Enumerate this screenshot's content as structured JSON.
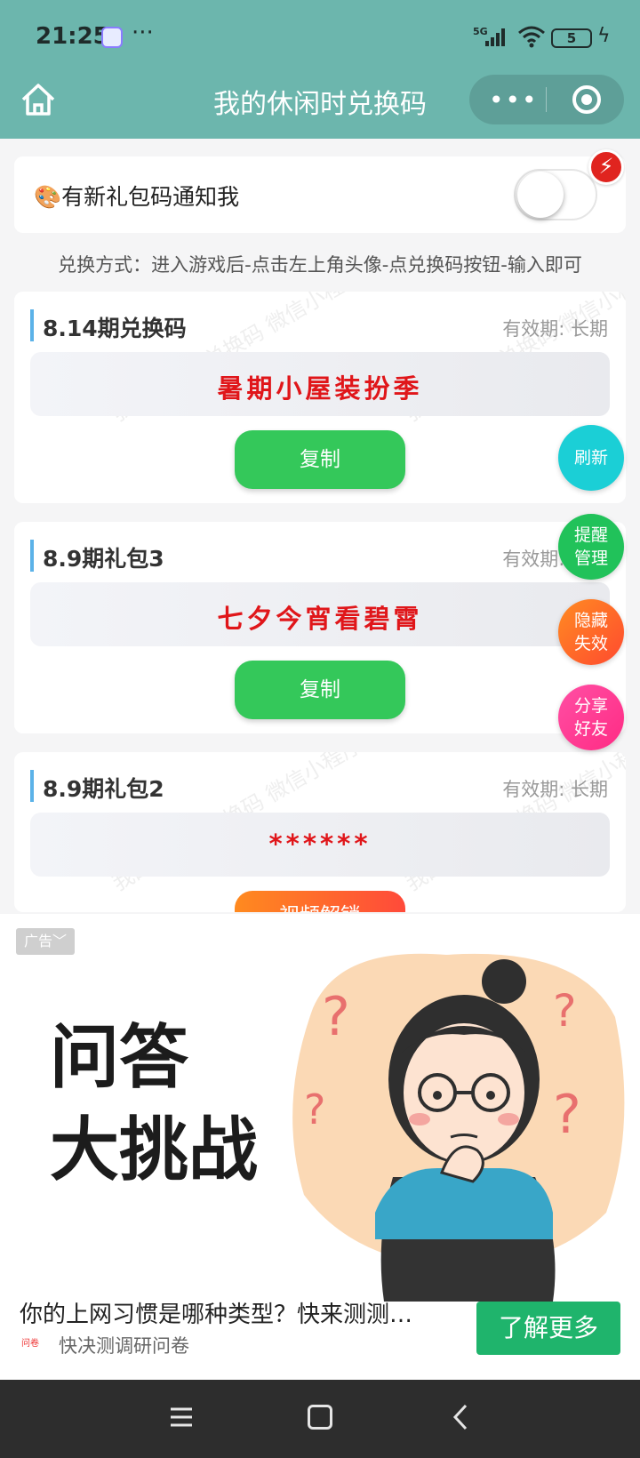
{
  "status_bar": {
    "time": "21:25",
    "more": "···",
    "network": "5G",
    "battery": "5"
  },
  "header": {
    "title": "我的休闲时兑换码",
    "capsule_more": "•••"
  },
  "notify": {
    "label": "🎨有新礼包码通知我",
    "badge": "⚡"
  },
  "instructions": "兑换方式：进入游戏后-点击左上角头像-点兑换码按钮-输入即可",
  "watermark": "我的休闲时兑换码 微信小程序",
  "codes": [
    {
      "title": "8.14期兑换码",
      "validity": "有效期: 长期",
      "code": "暑期小屋装扮季",
      "button": "复制"
    },
    {
      "title": "8.9期礼包3",
      "validity": "有效期: 长期",
      "code": "七夕今宵看碧霄",
      "button": "复制"
    },
    {
      "title": "8.9期礼包2",
      "validity": "有效期: 长期",
      "code": "******",
      "button": "视频解锁"
    }
  ],
  "float_buttons": {
    "refresh": "刷新",
    "remind": "提醒\n管理",
    "hide": "隐藏\n失效",
    "share": "分享\n好友"
  },
  "ad": {
    "tag": "广告﹀",
    "headline_line1": "问答",
    "headline_line2": "大挑战",
    "description": "你的上网习惯是哪种类型？快来测测…",
    "brand_logo": "问卷",
    "brand": "快决测调研问卷",
    "cta": "了解更多"
  },
  "colors": {
    "header": "#6cb6ad",
    "copy_button": "#34c85a",
    "code_text": "#e0161a",
    "cta": "#1fb46c"
  }
}
